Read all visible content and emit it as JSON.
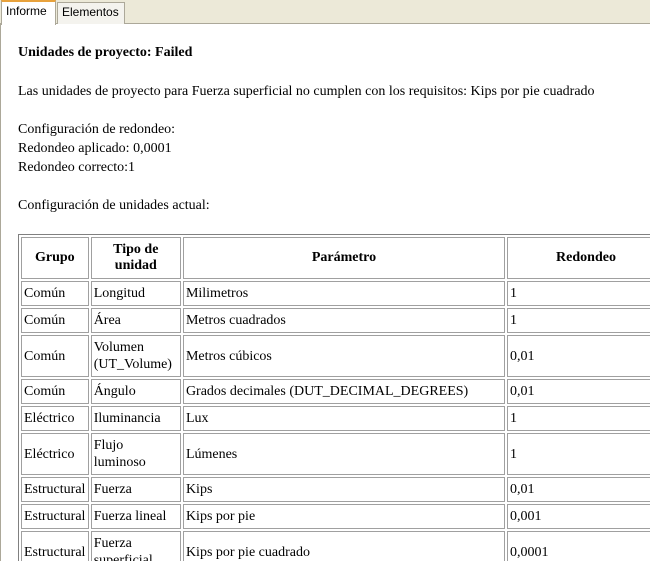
{
  "tabs": [
    {
      "label": "Informe",
      "active": true
    },
    {
      "label": "Elementos",
      "active": false
    }
  ],
  "report": {
    "heading": "Unidades de proyecto: Failed",
    "message": "Las unidades de proyecto para Fuerza superficial no cumplen con los requisitos: Kips por pie cuadrado",
    "rounding_title": "Configuración de redondeo:",
    "rounding_applied": "Redondeo aplicado: 0,0001",
    "rounding_correct": "Redondeo correcto:1",
    "current_title": "Configuración de unidades actual:"
  },
  "table": {
    "headers": [
      "Grupo",
      "Tipo de unidad",
      "Parámetro",
      "Redondeo"
    ],
    "rows": [
      [
        "Común",
        "Longitud",
        "Milimetros",
        "1"
      ],
      [
        "Común",
        "Área",
        "Metros cuadrados",
        "1"
      ],
      [
        "Común",
        "Volumen (UT_Volume)",
        "Metros cúbicos",
        "0,01"
      ],
      [
        "Común",
        "Ángulo",
        "Grados decimales (DUT_DECIMAL_DEGREES)",
        "0,01"
      ],
      [
        "Eléctrico",
        "Iluminancia",
        "Lux",
        "1"
      ],
      [
        "Eléctrico",
        "Flujo luminoso",
        "Lúmenes",
        "1"
      ],
      [
        "Estructural",
        "Fuerza",
        "Kips",
        "0,01"
      ],
      [
        "Estructural",
        "Fuerza lineal",
        "Kips por pie",
        "0,001"
      ],
      [
        "Estructural",
        "Fuerza superficial",
        "Kips por pie cuadrado",
        "0,0001"
      ]
    ]
  }
}
